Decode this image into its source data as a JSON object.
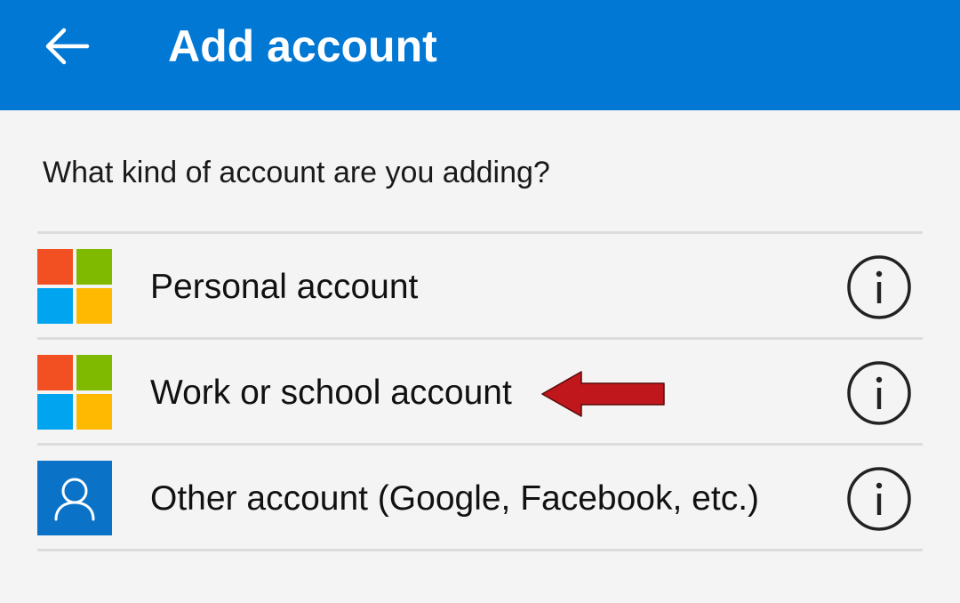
{
  "header": {
    "title": "Add account",
    "back_icon": "arrow-left-icon",
    "background_color": "#0078d4"
  },
  "prompt": "What kind of account are you adding?",
  "accounts": [
    {
      "label": "Personal account",
      "icon": "microsoft-logo-icon",
      "info_icon": "info-icon"
    },
    {
      "label": "Work or school account",
      "icon": "microsoft-logo-icon",
      "info_icon": "info-icon"
    },
    {
      "label": "Other account (Google, Facebook, etc.)",
      "icon": "person-icon",
      "info_icon": "info-icon"
    }
  ],
  "annotation": {
    "icon": "red-arrow-left-icon",
    "color": "#c0171c"
  },
  "colors": {
    "microsoft_red": "#f25022",
    "microsoft_green": "#7fba00",
    "microsoft_blue": "#00a4ef",
    "microsoft_yellow": "#ffb900",
    "person_tile": "#0a73c8"
  }
}
